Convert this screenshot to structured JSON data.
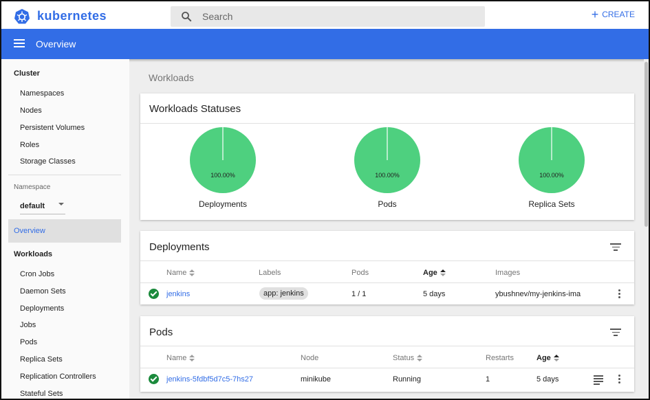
{
  "header": {
    "brand": "kubernetes",
    "search_placeholder": "Search",
    "create_label": "CREATE"
  },
  "toolbar": {
    "title": "Overview"
  },
  "sidebar": {
    "cluster_heading": "Cluster",
    "cluster_items": [
      "Namespaces",
      "Nodes",
      "Persistent Volumes",
      "Roles",
      "Storage Classes"
    ],
    "namespace_label": "Namespace",
    "namespace_value": "default",
    "active_item": "Overview",
    "workloads_heading": "Workloads",
    "workload_items": [
      "Cron Jobs",
      "Daemon Sets",
      "Deployments",
      "Jobs",
      "Pods",
      "Replica Sets",
      "Replication Controllers",
      "Stateful Sets"
    ]
  },
  "main": {
    "breadcrumb": "Workloads",
    "statuses": {
      "title": "Workloads Statuses",
      "charts": [
        {
          "label": "Deployments",
          "percent": "100.00%",
          "running_fraction": 1.0
        },
        {
          "label": "Pods",
          "percent": "100.00%",
          "running_fraction": 1.0
        },
        {
          "label": "Replica Sets",
          "percent": "100.00%",
          "running_fraction": 1.0
        }
      ]
    },
    "deployments": {
      "title": "Deployments",
      "columns": {
        "name": "Name",
        "labels": "Labels",
        "pods": "Pods",
        "age": "Age",
        "images": "Images"
      },
      "rows": [
        {
          "name": "jenkins",
          "label": "app: jenkins",
          "pods": "1 / 1",
          "age": "5 days",
          "images": "ybushnev/my-jenkins-ima"
        }
      ]
    },
    "pods": {
      "title": "Pods",
      "columns": {
        "name": "Name",
        "node": "Node",
        "status": "Status",
        "restarts": "Restarts",
        "age": "Age"
      },
      "rows": [
        {
          "name": "jenkins-5fdbf5d7c5-7hs27",
          "node": "minikube",
          "status": "Running",
          "restarts": "1",
          "age": "5 days"
        }
      ]
    }
  },
  "colors": {
    "brand": "#326de6",
    "pie_success": "#4ed07f",
    "ok_icon": "#1b8a3c"
  }
}
